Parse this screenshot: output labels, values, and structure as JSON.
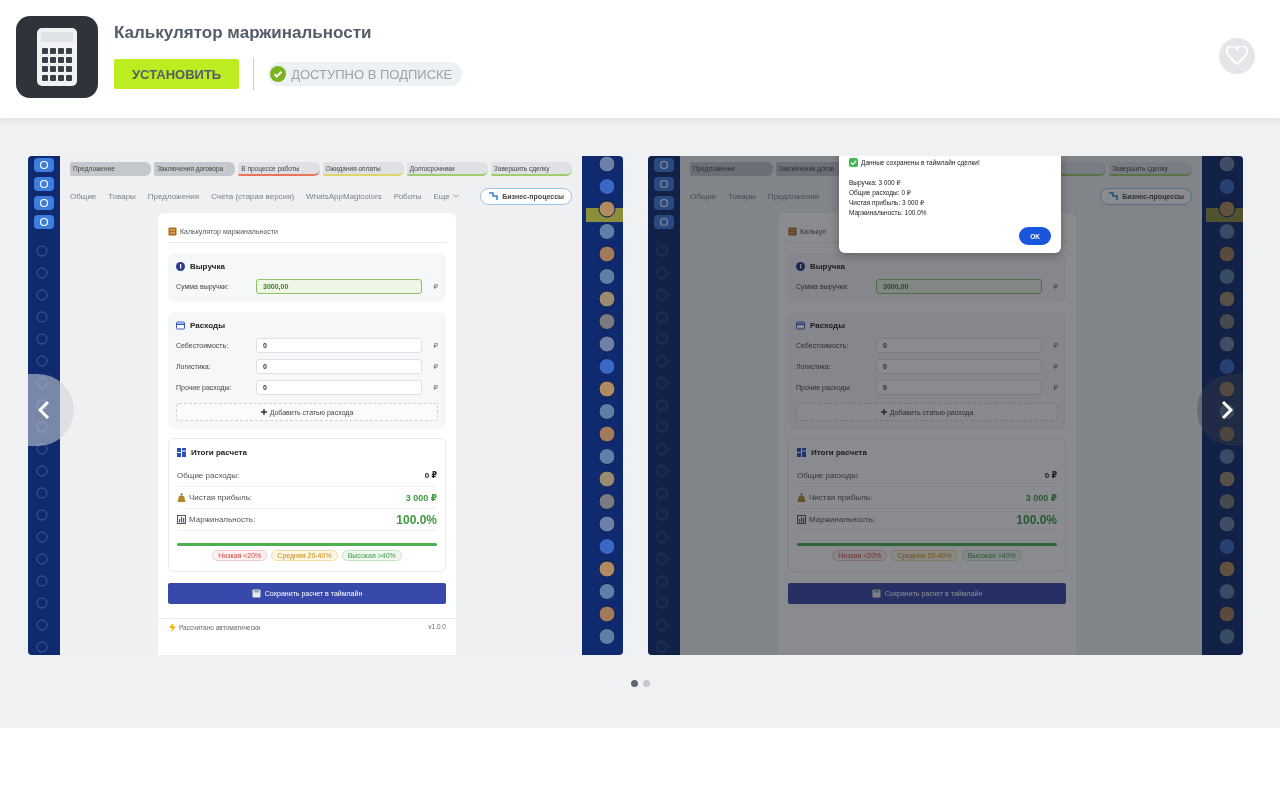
{
  "app": {
    "title": "Калькулятор маржинальности",
    "install_button": "УСТАНОВИТЬ",
    "subscription_badge": "ДОСТУПНО В ПОДПИСКЕ",
    "favorited": false
  },
  "gallery": {
    "slides": [
      {
        "dimmed": false,
        "stages": [
          {
            "kind": "done",
            "label": "Предложение",
            "passed": true
          },
          {
            "kind": "done",
            "label": "Заключения договора",
            "passed": true
          },
          {
            "kind": "current",
            "label": "В процессе работы",
            "passed": false
          },
          {
            "kind": "waiting",
            "label": "Ожидания оплаты",
            "passed": false
          },
          {
            "kind": "longterm",
            "label": "Долгосрочники",
            "passed": false
          },
          {
            "kind": "closing",
            "label": "Завершить сделку",
            "passed": false
          }
        ],
        "tabs": [
          "Общие",
          "Товары",
          "Предложения",
          "Счета (старая версия)",
          "WhatsAppMagicolors",
          "Роботы"
        ],
        "more_tab": "Еще",
        "business_button": "Бизнес-процессы",
        "calculator": {
          "title": "Калькулятор маржинальности",
          "revenue": {
            "title": "Выручка",
            "rows": [
              {
                "label": "Сумма выручки:",
                "value": "3000,00",
                "currency": "₽",
                "highlighted": true
              }
            ]
          },
          "expenses": {
            "title": "Расходы",
            "rows": [
              {
                "label": "Себестоимость:",
                "value": "0",
                "currency": "₽",
                "highlighted": false
              },
              {
                "label": "Логистика:",
                "value": "0",
                "currency": "₽",
                "highlighted": false
              },
              {
                "label": "Прочие расходы:",
                "value": "0",
                "currency": "₽",
                "highlighted": false
              }
            ],
            "add_button": "Добавить статью расхода"
          },
          "results": {
            "title": "Итоги расчета",
            "rows": [
              {
                "kind": "plain",
                "label": "Общие расходы:",
                "value": "0 ₽"
              },
              {
                "kind": "profit",
                "label": "Чистая прибыль:",
                "value": "3 000 ₽"
              },
              {
                "kind": "margin",
                "label": "Маржинальность:",
                "value": "100.0%"
              }
            ],
            "level": 1.0,
            "legend": [
              {
                "label": "Низкая <20%",
                "kind": "low"
              },
              {
                "label": "Средняя 20-40%",
                "kind": "medium"
              },
              {
                "label": "Высокая >40%",
                "kind": "high"
              }
            ]
          },
          "save_button": "Сохранить расчет в таймлайн",
          "footer": {
            "note": "Рассчитано автоматически",
            "version": "v1.0.0"
          }
        }
      },
      {
        "dimmed": true,
        "stages": [
          {
            "kind": "done",
            "label": "Предложение",
            "passed": true
          },
          {
            "kind": "done",
            "label": "Заключения догов",
            "passed": true
          },
          {
            "kind": "covered"
          },
          {
            "kind": "covered"
          },
          {
            "kind": "cutoff"
          },
          {
            "kind": "closing",
            "label": "Завершить сделку",
            "passed": false
          }
        ],
        "tabs": [
          "Общие",
          "Товары",
          "Предложения"
        ],
        "business_button": "Бизнес-процессы",
        "calculator": {
          "title": "Калькул",
          "revenue": {
            "title": "Выручка",
            "rows": [
              {
                "label": "Сумма выручки:",
                "value": "3000,00",
                "currency": "₽",
                "highlighted": true
              }
            ]
          },
          "expenses": {
            "title": "Расходы",
            "rows": [
              {
                "label": "Себестоимость:",
                "value": "0",
                "currency": "₽",
                "highlighted": false
              },
              {
                "label": "Логистика:",
                "value": "0",
                "currency": "₽",
                "highlighted": false
              },
              {
                "label": "Прочие расходы:",
                "value": "0",
                "currency": "₽",
                "highlighted": false
              }
            ],
            "add_button": "Добавить статью расхода"
          },
          "results": {
            "title": "Итоги расчета",
            "rows": [
              {
                "kind": "plain",
                "label": "Общие расходы:",
                "value": "0 ₽"
              },
              {
                "kind": "profit",
                "label": "Чистая прибыль:",
                "value": "3 000 ₽"
              },
              {
                "kind": "margin",
                "label": "Маржинальность:",
                "value": "100.0%"
              }
            ],
            "level": 1.0,
            "legend": [
              {
                "label": "Низкая <20%",
                "kind": "low"
              },
              {
                "label": "Средняя 20-40%",
                "kind": "medium"
              },
              {
                "label": "Высокая >40%",
                "kind": "high"
              }
            ]
          },
          "save_button": "Сохранить расчет в таймлайн"
        },
        "dialog": {
          "title": "Данные сохранены в таймлайн сделки!",
          "lines": [
            "Выручка: 3 000 ₽",
            "Общие расходы: 0 ₽",
            "Чистая прибыль: 3 000 ₽",
            "Маржинальность: 100.0%"
          ],
          "ok_button": "OK"
        }
      }
    ],
    "dots": [
      {
        "selected": true
      },
      {
        "selected": false
      }
    ]
  }
}
